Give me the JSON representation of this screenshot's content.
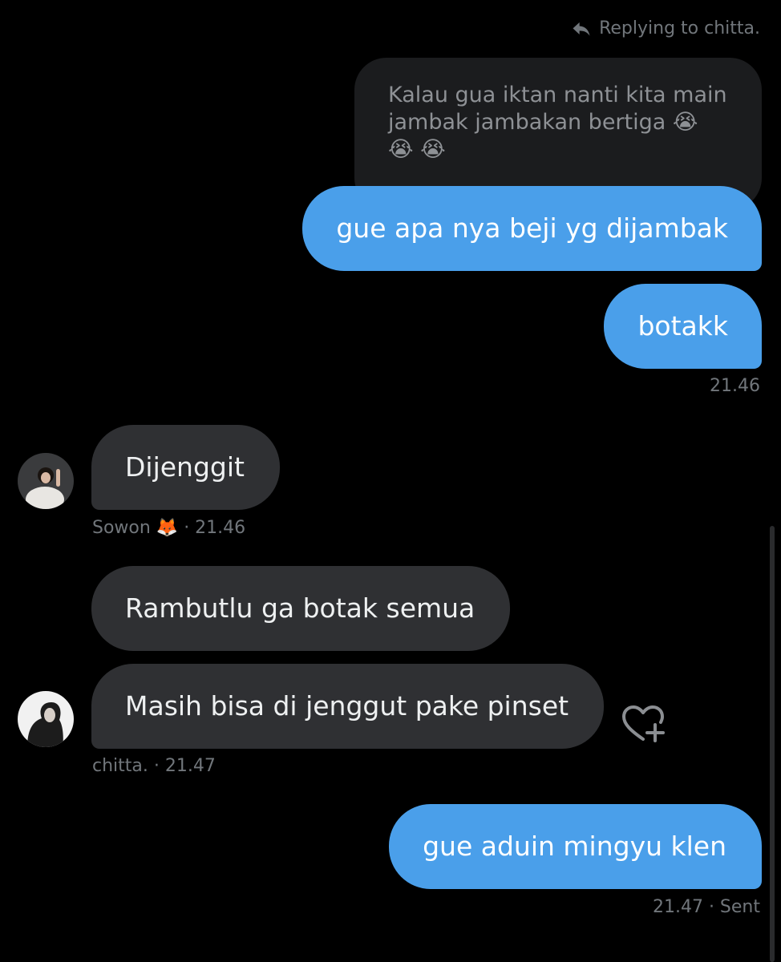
{
  "reply_context": {
    "label": "Replying to chitta."
  },
  "quoted_message": {
    "text": "Kalau gua iktan nanti kita main jambak jambakan bertiga 😭 😭 😭"
  },
  "messages": [
    {
      "text": "gue apa nya beji yg dijambak",
      "direction": "outgoing"
    },
    {
      "text": "botakk",
      "direction": "outgoing"
    },
    {
      "text": "Dijenggit",
      "direction": "incoming"
    },
    {
      "text": "Rambutlu ga botak semua",
      "direction": "incoming"
    },
    {
      "text": "Masih bisa di jenggut pake pinset",
      "direction": "incoming"
    },
    {
      "text": "gue aduin mingyu klen",
      "direction": "outgoing"
    }
  ],
  "meta": {
    "group1": "21.46",
    "group2": "Sowon 🦊 · 21.46",
    "group3": "chitta. · 21.47",
    "group4": "21.47 · Sent"
  },
  "icons": {
    "reply": "reply-arrow-icon",
    "react": "heart-plus-icon"
  },
  "colors": {
    "background": "#000000",
    "outgoing_bubble": "#4a9fea",
    "incoming_bubble": "#2f3033",
    "quoted_bubble": "#1b1c1e",
    "meta_text": "#71767b"
  }
}
